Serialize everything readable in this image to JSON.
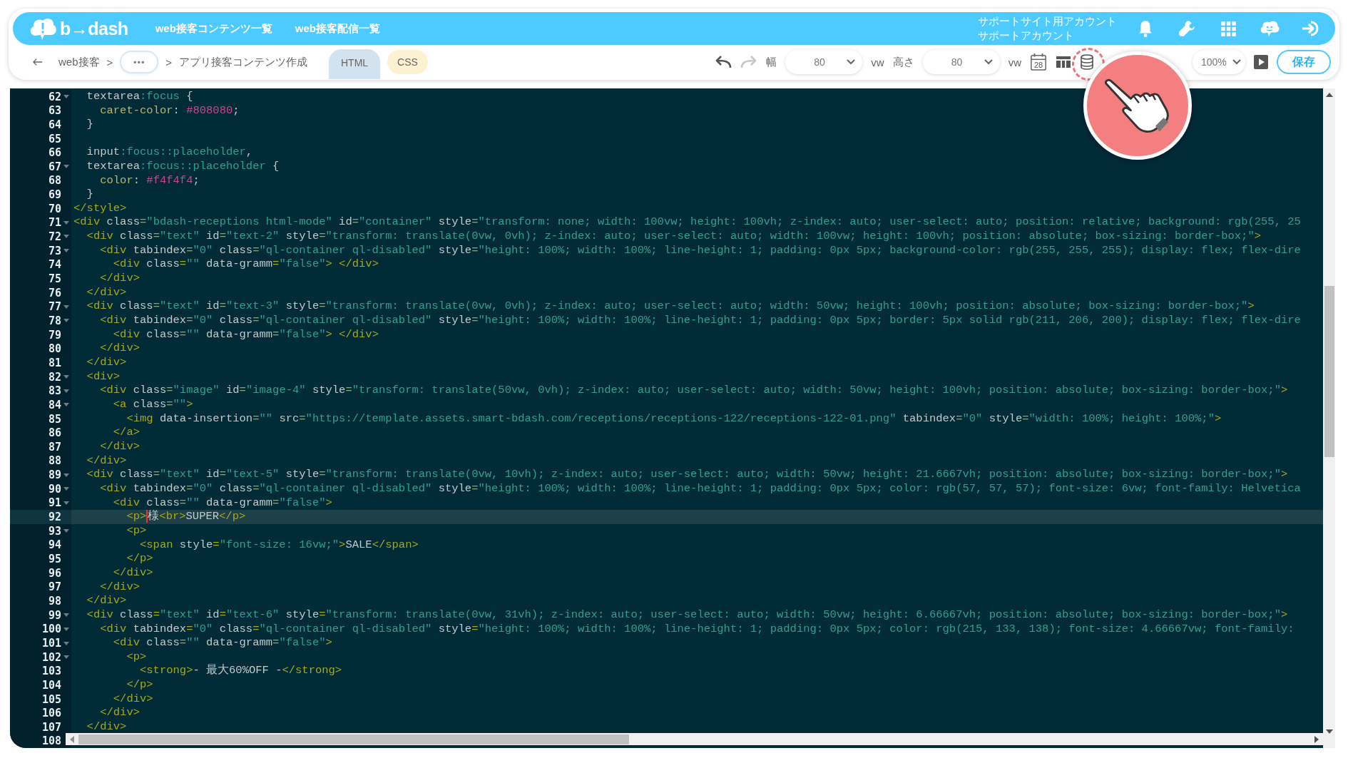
{
  "header": {
    "logo": "b→dash",
    "nav": [
      {
        "label": "web接客コンテンツ一覧"
      },
      {
        "label": "web接客配信一覧"
      }
    ],
    "account": [
      "サポートサイト用アカウント",
      "サポートアカウント"
    ],
    "icons": [
      {
        "kind": "bell"
      },
      {
        "kind": "wrench"
      },
      {
        "kind": "grid"
      },
      {
        "kind": "chat"
      },
      {
        "kind": "login"
      }
    ]
  },
  "toolbar": {
    "breadcrumb": [
      {
        "kind": "link",
        "label": "web接客"
      },
      {
        "kind": "sep",
        "label": ">"
      },
      {
        "kind": "more",
        "label": "•••"
      },
      {
        "kind": "sep",
        "label": ">"
      },
      {
        "kind": "current",
        "label": "アプリ接客コンテンツ作成"
      }
    ],
    "tabs": [
      {
        "label": "HTML",
        "selected": true,
        "color": "#d3e2ef"
      },
      {
        "label": "CSS",
        "selected": false,
        "color": "#fcf2d2"
      }
    ],
    "undo": {
      "disabled": false
    },
    "redo": {
      "disabled": true
    },
    "width": {
      "label": "幅",
      "value": "80",
      "unit": "vw"
    },
    "height": {
      "label": "高さ",
      "value": "80",
      "unit": "vw"
    },
    "calendar_day": "28",
    "zoom": "100%",
    "save": "保存"
  },
  "editor": {
    "lines": [
      {
        "number": "62",
        "fold": true,
        "current": false,
        "tokens": [
          {
            "kind": "sel",
            "text": "  textarea"
          },
          {
            "kind": "pseudo",
            "text": ":focus"
          },
          {
            "kind": "punct",
            "text": " {"
          }
        ]
      },
      {
        "number": "63",
        "fold": false,
        "current": false,
        "tokens": [
          {
            "kind": "prop",
            "text": "    caret-color"
          },
          {
            "kind": "punct",
            "text": ": "
          },
          {
            "kind": "val",
            "text": "#808080"
          },
          {
            "kind": "punct",
            "text": ";"
          }
        ]
      },
      {
        "number": "64",
        "fold": false,
        "current": false,
        "tokens": [
          {
            "kind": "punct",
            "text": "  }"
          }
        ]
      },
      {
        "number": "65",
        "fold": false,
        "current": false
      },
      {
        "number": "66",
        "fold": false,
        "current": false,
        "tokens": [
          {
            "kind": "sel",
            "text": "  input"
          },
          {
            "kind": "pseudo",
            "text": ":focus::placeholder"
          },
          {
            "kind": "punct",
            "text": ","
          }
        ]
      },
      {
        "number": "67",
        "fold": true,
        "current": false,
        "tokens": [
          {
            "kind": "sel",
            "text": "  textarea"
          },
          {
            "kind": "pseudo",
            "text": ":focus::placeholder"
          },
          {
            "kind": "punct",
            "text": " {"
          }
        ]
      },
      {
        "number": "68",
        "fold": false,
        "current": false,
        "tokens": [
          {
            "kind": "prop",
            "text": "    color"
          },
          {
            "kind": "punct",
            "text": ": "
          },
          {
            "kind": "val",
            "text": "#f4f4f4"
          },
          {
            "kind": "punct",
            "text": ";"
          }
        ]
      },
      {
        "number": "69",
        "fold": false,
        "current": false,
        "tokens": [
          {
            "kind": "punct",
            "text": "  }"
          }
        ]
      },
      {
        "number": "70",
        "fold": false,
        "current": false,
        "tokens": [
          {
            "kind": "tag",
            "text": "</style>"
          }
        ]
      },
      {
        "number": "71",
        "fold": true,
        "current": false,
        "tokens": [
          {
            "kind": "tag",
            "text": "<div"
          },
          {
            "kind": "attr",
            "text": " class"
          },
          {
            "kind": "eq",
            "text": "="
          },
          {
            "kind": "str",
            "text": "\"bdash-receptions html-mode\""
          },
          {
            "kind": "attr",
            "text": " id"
          },
          {
            "kind": "eq",
            "text": "="
          },
          {
            "kind": "str",
            "text": "\"container\""
          },
          {
            "kind": "attr",
            "text": " style"
          },
          {
            "kind": "eq",
            "text": "="
          },
          {
            "kind": "str",
            "text": "\"transform: none; width: 100vw; height: 100vh; z-index: auto; user-select: auto; position: relative; background: rgb(255, 25"
          }
        ]
      },
      {
        "number": "72",
        "fold": true,
        "current": false,
        "tokens": [
          {
            "kind": "tag",
            "text": "  <div"
          },
          {
            "kind": "attr",
            "text": " class"
          },
          {
            "kind": "eq",
            "text": "="
          },
          {
            "kind": "str",
            "text": "\"text\""
          },
          {
            "kind": "attr",
            "text": " id"
          },
          {
            "kind": "eq",
            "text": "="
          },
          {
            "kind": "str",
            "text": "\"text-2\""
          },
          {
            "kind": "attr",
            "text": " style"
          },
          {
            "kind": "eq",
            "text": "="
          },
          {
            "kind": "str",
            "text": "\"transform: translate(0vw, 0vh); z-index: auto; user-select: auto; width: 100vw; height: 100vh; position: absolute; box-sizing: border-box;\""
          },
          {
            "kind": "tag",
            "text": ">"
          }
        ]
      },
      {
        "number": "73",
        "fold": true,
        "current": false,
        "tokens": [
          {
            "kind": "tag",
            "text": "    <div"
          },
          {
            "kind": "attr",
            "text": " tabindex"
          },
          {
            "kind": "eq",
            "text": "="
          },
          {
            "kind": "str",
            "text": "\"0\""
          },
          {
            "kind": "attr",
            "text": " class"
          },
          {
            "kind": "eq",
            "text": "="
          },
          {
            "kind": "str",
            "text": "\"ql-container ql-disabled\""
          },
          {
            "kind": "attr",
            "text": " style"
          },
          {
            "kind": "eq",
            "text": "="
          },
          {
            "kind": "str",
            "text": "\"height: 100%; width: 100%; line-height: 1; padding: 0px 5px; background-color: rgb(255, 255, 255); display: flex; flex-dire"
          }
        ]
      },
      {
        "number": "74",
        "fold": false,
        "current": false,
        "tokens": [
          {
            "kind": "tag",
            "text": "      <div"
          },
          {
            "kind": "attr",
            "text": " class"
          },
          {
            "kind": "eq",
            "text": "="
          },
          {
            "kind": "str",
            "text": "\"\""
          },
          {
            "kind": "attr",
            "text": " data-gramm"
          },
          {
            "kind": "eq",
            "text": "="
          },
          {
            "kind": "str",
            "text": "\"false\""
          },
          {
            "kind": "tag",
            "text": "> </div>"
          }
        ]
      },
      {
        "number": "75",
        "fold": false,
        "current": false,
        "tokens": [
          {
            "kind": "tag",
            "text": "    </div>"
          }
        ]
      },
      {
        "number": "76",
        "fold": false,
        "current": false,
        "tokens": [
          {
            "kind": "tag",
            "text": "  </div>"
          }
        ]
      },
      {
        "number": "77",
        "fold": true,
        "current": false,
        "tokens": [
          {
            "kind": "tag",
            "text": "  <div"
          },
          {
            "kind": "attr",
            "text": " class"
          },
          {
            "kind": "eq",
            "text": "="
          },
          {
            "kind": "str",
            "text": "\"text\""
          },
          {
            "kind": "attr",
            "text": " id"
          },
          {
            "kind": "eq",
            "text": "="
          },
          {
            "kind": "str",
            "text": "\"text-3\""
          },
          {
            "kind": "attr",
            "text": " style"
          },
          {
            "kind": "eq",
            "text": "="
          },
          {
            "kind": "str",
            "text": "\"transform: translate(0vw, 0vh); z-index: auto; user-select: auto; width: 50vw; height: 100vh; position: absolute; box-sizing: border-box;\""
          },
          {
            "kind": "tag",
            "text": ">"
          }
        ]
      },
      {
        "number": "78",
        "fold": true,
        "current": false,
        "tokens": [
          {
            "kind": "tag",
            "text": "    <div"
          },
          {
            "kind": "attr",
            "text": " tabindex"
          },
          {
            "kind": "eq",
            "text": "="
          },
          {
            "kind": "str",
            "text": "\"0\""
          },
          {
            "kind": "attr",
            "text": " class"
          },
          {
            "kind": "eq",
            "text": "="
          },
          {
            "kind": "str",
            "text": "\"ql-container ql-disabled\""
          },
          {
            "kind": "attr",
            "text": " style"
          },
          {
            "kind": "eq",
            "text": "="
          },
          {
            "kind": "str",
            "text": "\"height: 100%; width: 100%; line-height: 1; padding: 0px 5px; border: 5px solid rgb(211, 206, 200); display: flex; flex-dire"
          }
        ]
      },
      {
        "number": "79",
        "fold": false,
        "current": false,
        "tokens": [
          {
            "kind": "tag",
            "text": "      <div"
          },
          {
            "kind": "attr",
            "text": " class"
          },
          {
            "kind": "eq",
            "text": "="
          },
          {
            "kind": "str",
            "text": "\"\""
          },
          {
            "kind": "attr",
            "text": " data-gramm"
          },
          {
            "kind": "eq",
            "text": "="
          },
          {
            "kind": "str",
            "text": "\"false\""
          },
          {
            "kind": "tag",
            "text": "> </div>"
          }
        ]
      },
      {
        "number": "80",
        "fold": false,
        "current": false,
        "tokens": [
          {
            "kind": "tag",
            "text": "    </div>"
          }
        ]
      },
      {
        "number": "81",
        "fold": false,
        "current": false,
        "tokens": [
          {
            "kind": "tag",
            "text": "  </div>"
          }
        ]
      },
      {
        "number": "82",
        "fold": true,
        "current": false,
        "tokens": [
          {
            "kind": "tag",
            "text": "  <div>"
          }
        ]
      },
      {
        "number": "83",
        "fold": true,
        "current": false,
        "tokens": [
          {
            "kind": "tag",
            "text": "    <div"
          },
          {
            "kind": "attr",
            "text": " class"
          },
          {
            "kind": "eq",
            "text": "="
          },
          {
            "kind": "str",
            "text": "\"image\""
          },
          {
            "kind": "attr",
            "text": " id"
          },
          {
            "kind": "eq",
            "text": "="
          },
          {
            "kind": "str",
            "text": "\"image-4\""
          },
          {
            "kind": "attr",
            "text": " style"
          },
          {
            "kind": "eq",
            "text": "="
          },
          {
            "kind": "str",
            "text": "\"transform: translate(50vw, 0vh); z-index: auto; user-select: auto; width: 50vw; height: 100vh; position: absolute; box-sizing: border-box;\""
          },
          {
            "kind": "tag",
            "text": ">"
          }
        ]
      },
      {
        "number": "84",
        "fold": true,
        "current": false,
        "tokens": [
          {
            "kind": "tag",
            "text": "      <a"
          },
          {
            "kind": "attr",
            "text": " class"
          },
          {
            "kind": "eq",
            "text": "="
          },
          {
            "kind": "str",
            "text": "\"\""
          },
          {
            "kind": "tag",
            "text": ">"
          }
        ]
      },
      {
        "number": "85",
        "fold": false,
        "current": false,
        "tokens": [
          {
            "kind": "tag",
            "text": "        <img"
          },
          {
            "kind": "attr",
            "text": " data-insertion"
          },
          {
            "kind": "eq",
            "text": "="
          },
          {
            "kind": "str",
            "text": "\"\""
          },
          {
            "kind": "attr",
            "text": " src"
          },
          {
            "kind": "eq",
            "text": "="
          },
          {
            "kind": "str",
            "text": "\"https://template.assets.smart-bdash.com/receptions/receptions-122/receptions-122-01.png\""
          },
          {
            "kind": "attr",
            "text": " tabindex"
          },
          {
            "kind": "eq",
            "text": "="
          },
          {
            "kind": "str",
            "text": "\"0\""
          },
          {
            "kind": "attr",
            "text": " style"
          },
          {
            "kind": "eq",
            "text": "="
          },
          {
            "kind": "str",
            "text": "\"width: 100%; height: 100%;\""
          },
          {
            "kind": "tag",
            "text": ">"
          }
        ]
      },
      {
        "number": "86",
        "fold": false,
        "current": false,
        "tokens": [
          {
            "kind": "tag",
            "text": "      </a>"
          }
        ]
      },
      {
        "number": "87",
        "fold": false,
        "current": false,
        "tokens": [
          {
            "kind": "tag",
            "text": "    </div>"
          }
        ]
      },
      {
        "number": "88",
        "fold": false,
        "current": false,
        "tokens": [
          {
            "kind": "tag",
            "text": "  </div>"
          }
        ]
      },
      {
        "number": "89",
        "fold": true,
        "current": false,
        "tokens": [
          {
            "kind": "tag",
            "text": "  <div"
          },
          {
            "kind": "attr",
            "text": " class"
          },
          {
            "kind": "eq",
            "text": "="
          },
          {
            "kind": "str",
            "text": "\"text\""
          },
          {
            "kind": "attr",
            "text": " id"
          },
          {
            "kind": "eq",
            "text": "="
          },
          {
            "kind": "str",
            "text": "\"text-5\""
          },
          {
            "kind": "attr",
            "text": " style"
          },
          {
            "kind": "eq",
            "text": "="
          },
          {
            "kind": "str",
            "text": "\"transform: translate(0vw, 10vh); z-index: auto; user-select: auto; width: 50vw; height: 21.6667vh; position: absolute; box-sizing: border-box;\""
          },
          {
            "kind": "tag",
            "text": ">"
          }
        ]
      },
      {
        "number": "90",
        "fold": true,
        "current": false,
        "tokens": [
          {
            "kind": "tag",
            "text": "    <div"
          },
          {
            "kind": "attr",
            "text": " tabindex"
          },
          {
            "kind": "eq",
            "text": "="
          },
          {
            "kind": "str",
            "text": "\"0\""
          },
          {
            "kind": "attr",
            "text": " class"
          },
          {
            "kind": "eq",
            "text": "="
          },
          {
            "kind": "str",
            "text": "\"ql-container ql-disabled\""
          },
          {
            "kind": "attr",
            "text": " style"
          },
          {
            "kind": "eq",
            "text": "="
          },
          {
            "kind": "str",
            "text": "\"height: 100%; width: 100%; line-height: 1; padding: 0px 5px; color: rgb(57, 57, 57); font-size: 6vw; font-family: Helvetica"
          }
        ]
      },
      {
        "number": "91",
        "fold": true,
        "current": false,
        "tokens": [
          {
            "kind": "tag",
            "text": "      <div"
          },
          {
            "kind": "attr",
            "text": " class"
          },
          {
            "kind": "eq",
            "text": "="
          },
          {
            "kind": "str",
            "text": "\"\""
          },
          {
            "kind": "attr",
            "text": " data-gramm"
          },
          {
            "kind": "eq",
            "text": "="
          },
          {
            "kind": "str",
            "text": "\"false\""
          },
          {
            "kind": "tag",
            "text": ">"
          }
        ]
      },
      {
        "number": "92",
        "fold": false,
        "current": true,
        "tokens": [
          {
            "kind": "tag",
            "text": "        <p>"
          },
          {
            "kind": "text",
            "text": "様",
            "caret": true
          },
          {
            "kind": "tag",
            "text": "<br>"
          },
          {
            "kind": "text",
            "text": "SUPER"
          },
          {
            "kind": "tag",
            "text": "</p>"
          }
        ]
      },
      {
        "number": "93",
        "fold": true,
        "current": false,
        "tokens": [
          {
            "kind": "tag",
            "text": "        <p>"
          }
        ]
      },
      {
        "number": "94",
        "fold": false,
        "current": false,
        "tokens": [
          {
            "kind": "tag",
            "text": "          <span"
          },
          {
            "kind": "attr",
            "text": " style"
          },
          {
            "kind": "eq",
            "text": "="
          },
          {
            "kind": "str",
            "text": "\"font-size: 16vw;\""
          },
          {
            "kind": "tag",
            "text": ">"
          },
          {
            "kind": "text",
            "text": "SALE"
          },
          {
            "kind": "tag",
            "text": "</span>"
          }
        ]
      },
      {
        "number": "95",
        "fold": false,
        "current": false,
        "tokens": [
          {
            "kind": "tag",
            "text": "        </p>"
          }
        ]
      },
      {
        "number": "96",
        "fold": false,
        "current": false,
        "tokens": [
          {
            "kind": "tag",
            "text": "      </div>"
          }
        ]
      },
      {
        "number": "97",
        "fold": false,
        "current": false,
        "tokens": [
          {
            "kind": "tag",
            "text": "    </div>"
          }
        ]
      },
      {
        "number": "98",
        "fold": false,
        "current": false,
        "tokens": [
          {
            "kind": "tag",
            "text": "  </div>"
          }
        ]
      },
      {
        "number": "99",
        "fold": true,
        "current": false,
        "tokens": [
          {
            "kind": "tag",
            "text": "  <div"
          },
          {
            "kind": "attr",
            "text": " class"
          },
          {
            "kind": "eq",
            "text": "="
          },
          {
            "kind": "str",
            "text": "\"text\""
          },
          {
            "kind": "attr",
            "text": " id"
          },
          {
            "kind": "eq",
            "text": "="
          },
          {
            "kind": "str",
            "text": "\"text-6\""
          },
          {
            "kind": "attr",
            "text": " style"
          },
          {
            "kind": "eq",
            "text": "="
          },
          {
            "kind": "str",
            "text": "\"transform: translate(0vw, 31vh); z-index: auto; user-select: auto; width: 50vw; height: 6.66667vh; position: absolute; box-sizing: border-box;\""
          },
          {
            "kind": "tag",
            "text": ">"
          }
        ]
      },
      {
        "number": "100",
        "fold": true,
        "current": false,
        "tokens": [
          {
            "kind": "tag",
            "text": "    <div"
          },
          {
            "kind": "attr",
            "text": " tabindex"
          },
          {
            "kind": "eq",
            "text": "="
          },
          {
            "kind": "str",
            "text": "\"0\""
          },
          {
            "kind": "attr",
            "text": " class"
          },
          {
            "kind": "eq",
            "text": "="
          },
          {
            "kind": "str",
            "text": "\"ql-container ql-disabled\""
          },
          {
            "kind": "attr",
            "text": " style"
          },
          {
            "kind": "eq",
            "text": "="
          },
          {
            "kind": "str",
            "text": "\"height: 100%; width: 100%; line-height: 1; padding: 0px 5px; color: rgb(215, 133, 138); font-size: 4.66667vw; font-family:"
          }
        ]
      },
      {
        "number": "101",
        "fold": true,
        "current": false,
        "tokens": [
          {
            "kind": "tag",
            "text": "      <div"
          },
          {
            "kind": "attr",
            "text": " class"
          },
          {
            "kind": "eq",
            "text": "="
          },
          {
            "kind": "str",
            "text": "\"\""
          },
          {
            "kind": "attr",
            "text": " data-gramm"
          },
          {
            "kind": "eq",
            "text": "="
          },
          {
            "kind": "str",
            "text": "\"false\""
          },
          {
            "kind": "tag",
            "text": ">"
          }
        ]
      },
      {
        "number": "102",
        "fold": true,
        "current": false,
        "tokens": [
          {
            "kind": "tag",
            "text": "        <p>"
          }
        ]
      },
      {
        "number": "103",
        "fold": false,
        "current": false,
        "tokens": [
          {
            "kind": "tag",
            "text": "          <strong>"
          },
          {
            "kind": "text",
            "text": "- 最大60%OFF -"
          },
          {
            "kind": "tag",
            "text": "</strong>"
          }
        ]
      },
      {
        "number": "104",
        "fold": false,
        "current": false,
        "tokens": [
          {
            "kind": "tag",
            "text": "        </p>"
          }
        ]
      },
      {
        "number": "105",
        "fold": false,
        "current": false,
        "tokens": [
          {
            "kind": "tag",
            "text": "      </div>"
          }
        ]
      },
      {
        "number": "106",
        "fold": false,
        "current": false,
        "tokens": [
          {
            "kind": "tag",
            "text": "    </div>"
          }
        ]
      },
      {
        "number": "107",
        "fold": false,
        "current": false,
        "tokens": [
          {
            "kind": "tag",
            "text": "  </div>"
          }
        ]
      },
      {
        "number": "108",
        "fold": false,
        "current": false
      }
    ]
  }
}
